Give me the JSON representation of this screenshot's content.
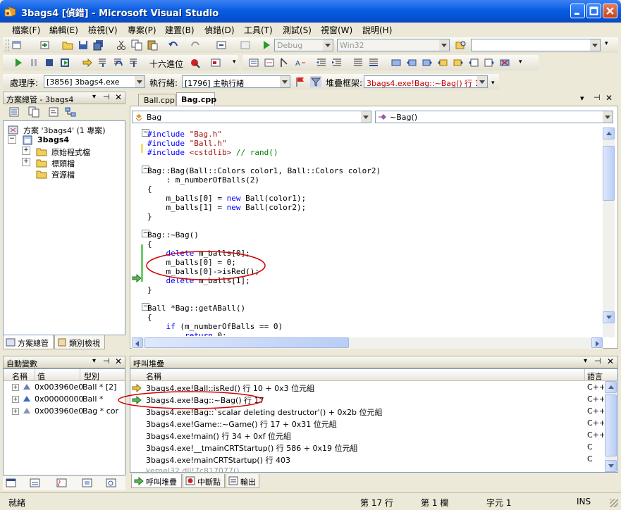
{
  "window": {
    "title": "3bags4 [偵錯] - Microsoft Visual Studio"
  },
  "menu": [
    "檔案(F)",
    "編輯(E)",
    "檢視(V)",
    "專案(P)",
    "建置(B)",
    "偵錯(D)",
    "工具(T)",
    "測試(S)",
    "視窗(W)",
    "說明(H)"
  ],
  "toolbar1": {
    "config": "Debug",
    "platform": "Win32"
  },
  "toolbar2": {
    "hex_label": "十六進位"
  },
  "toolbar3": {
    "process_label": "處理序:",
    "process_value": "[3856] 3bags4.exe",
    "thread_label": "執行緒:",
    "thread_value": "[1796] 主執行緒",
    "stack_label": "堆疊框架:",
    "stack_value": "3bags4.exe!Bag::~Bag()  行 17",
    "stack_color": "#c00000"
  },
  "solution_explorer": {
    "title": "方案總管 - 3bags4",
    "solution": "方案 '3bags4' (1 專案)",
    "project": "3bags4",
    "folders": [
      "原始程式檔",
      "標頭檔",
      "資源檔"
    ],
    "tabs": [
      "方案總管",
      "類別檢視"
    ]
  },
  "editor": {
    "tabs": [
      "Ball.cpp",
      "Bag.cpp"
    ],
    "class_combo": "Bag",
    "member_combo": "~Bag()",
    "lines": [
      [
        {
          "t": "#include ",
          "c": "pp"
        },
        {
          "t": "\"Bag.h\"",
          "c": "str"
        }
      ],
      [
        {
          "t": "#include ",
          "c": "pp"
        },
        {
          "t": "\"Ball.h\"",
          "c": "str"
        }
      ],
      [
        {
          "t": "#include ",
          "c": "pp"
        },
        {
          "t": "<cstdlib>",
          "c": "str"
        },
        {
          "t": " // rand()",
          "c": "cm"
        }
      ],
      [],
      [
        {
          "t": "Bag::Bag(Ball::Colors color1, Ball::Colors color2)",
          "c": ""
        }
      ],
      [
        {
          "t": "    : m_numberOfBalls(2)",
          "c": ""
        }
      ],
      [
        {
          "t": "{",
          "c": ""
        }
      ],
      [
        {
          "t": "    m_balls[0] = ",
          "c": ""
        },
        {
          "t": "new",
          "c": "kw"
        },
        {
          "t": " Ball(color1);",
          "c": ""
        }
      ],
      [
        {
          "t": "    m_balls[1] = ",
          "c": ""
        },
        {
          "t": "new",
          "c": "kw"
        },
        {
          "t": " Ball(color2);",
          "c": ""
        }
      ],
      [
        {
          "t": "}",
          "c": ""
        }
      ],
      [],
      [
        {
          "t": "Bag::~Bag()",
          "c": ""
        }
      ],
      [
        {
          "t": "{",
          "c": ""
        }
      ],
      [
        {
          "t": "    ",
          "c": ""
        },
        {
          "t": "delete",
          "c": "kw"
        },
        {
          "t": " m_balls[0];",
          "c": ""
        }
      ],
      [
        {
          "t": "    m_balls[0] = 0;",
          "c": ""
        }
      ],
      [
        {
          "t": "    m_balls[0]->isRed();",
          "c": ""
        }
      ],
      [
        {
          "t": "    ",
          "c": ""
        },
        {
          "t": "delete",
          "c": "kw"
        },
        {
          "t": " m_balls[1];",
          "c": ""
        }
      ],
      [
        {
          "t": "}",
          "c": ""
        }
      ],
      [],
      [
        {
          "t": "Ball *Bag::getABall()",
          "c": ""
        }
      ],
      [
        {
          "t": "{",
          "c": ""
        }
      ],
      [
        {
          "t": "    ",
          "c": ""
        },
        {
          "t": "if",
          "c": "kw"
        },
        {
          "t": " (m_numberOfBalls == 0)",
          "c": ""
        }
      ],
      [
        {
          "t": "        ",
          "c": ""
        },
        {
          "t": "return",
          "c": "kw"
        },
        {
          "t": " 0;",
          "c": ""
        }
      ]
    ]
  },
  "locals": {
    "title": "自動變數",
    "columns": [
      "名稱",
      "值",
      "型別"
    ],
    "rows": [
      {
        "value": "0x003960e0",
        "type": "Ball * [2]"
      },
      {
        "value": "0x00000000",
        "type": "Ball *"
      },
      {
        "value": "0x003960e0",
        "type": "Bag * cor"
      }
    ]
  },
  "callstack": {
    "title": "呼叫堆疊",
    "columns": [
      "名稱",
      "語言"
    ],
    "rows": [
      {
        "name": "3bags4.exe!Ball::isRed()  行 10 + 0x3 位元組",
        "lang": "C++"
      },
      {
        "name": "3bags4.exe!Bag::~Bag()  行 17",
        "lang": "C++"
      },
      {
        "name": "3bags4.exe!Bag::`scalar deleting destructor'()  + 0x2b 位元組",
        "lang": "C++"
      },
      {
        "name": "3bags4.exe!Game::~Game()  行 17 + 0x31 位元組",
        "lang": "C++"
      },
      {
        "name": "3bags4.exe!main()  行 34 + 0xf 位元組",
        "lang": "C++"
      },
      {
        "name": "3bags4.exe!__tmainCRTStartup()  行 586 + 0x19 位元組",
        "lang": "C"
      },
      {
        "name": "3bags4.exe!mainCRTStartup()  行 403",
        "lang": "C"
      },
      {
        "name": "kernel32.dll!7c817077()",
        "lang": ""
      }
    ],
    "tabs": [
      "呼叫堆疊",
      "中斷點",
      "輸出"
    ]
  },
  "status": {
    "ready": "就緒",
    "line": "第 17 行",
    "col": "第 1 欄",
    "char": "字元 1",
    "mode": "INS"
  },
  "colors": {
    "titlebar": "#0a5de1",
    "annotation": "#d40000",
    "current_stmt": "#ffff00"
  }
}
